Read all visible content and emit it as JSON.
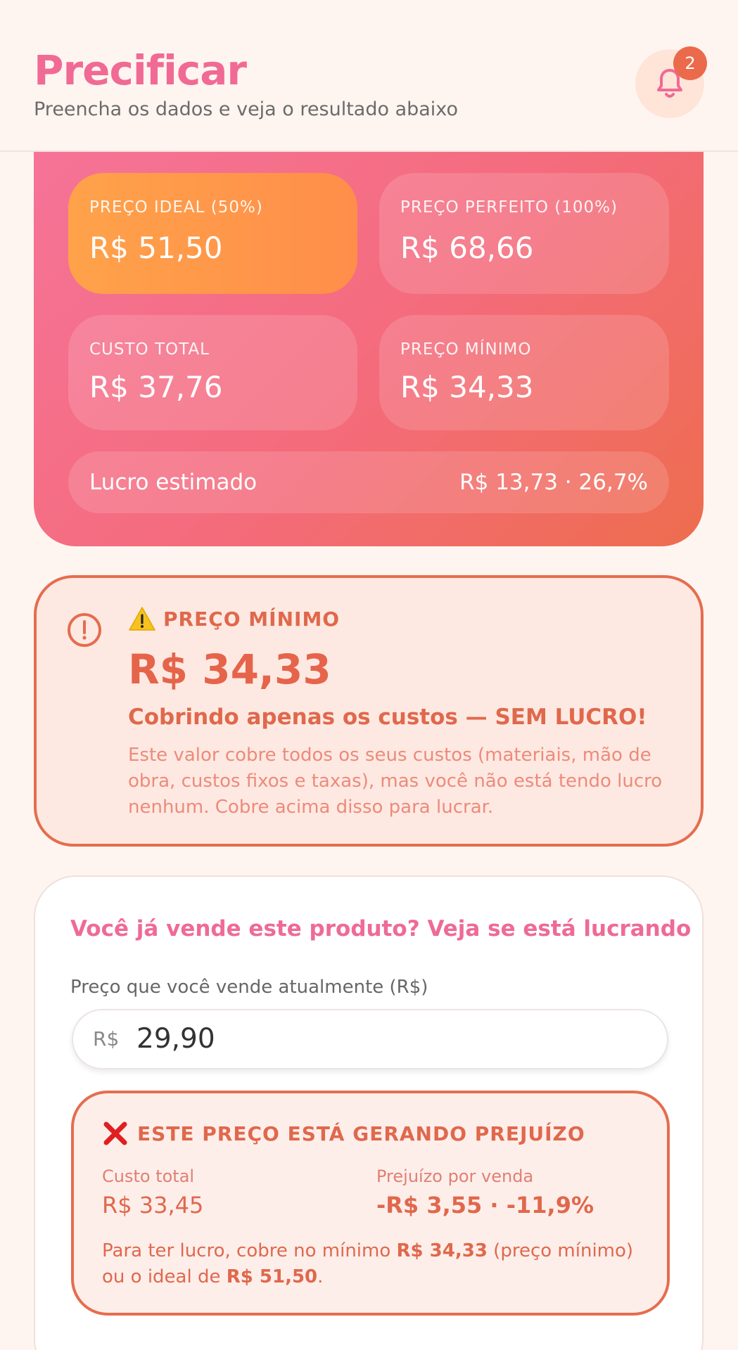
{
  "header": {
    "title": "Precificar",
    "subtitle": "Preencha os dados e veja o resultado abaixo",
    "notification_count": "2"
  },
  "result": {
    "ideal_label": "PREÇO IDEAL (50%)",
    "ideal_value": "R$ 51,50",
    "perfect_label": "PREÇO PERFEITO (100%)",
    "perfect_value": "R$ 68,66",
    "total_cost_label": "CUSTO TOTAL",
    "total_cost_value": "R$ 37,76",
    "min_price_label": "PREÇO MÍNIMO",
    "min_price_value": "R$ 34,33",
    "profit_label": "Lucro estimado",
    "profit_value": "R$ 13,73 · 26,7%"
  },
  "warning": {
    "title": "PREÇO MÍNIMO",
    "amount": "R$ 34,33",
    "headline": "Cobrindo apenas os custos — SEM LUCRO!",
    "description": "Este valor cobre todos os seus custos (materiais, mão de obra, custos fixos e taxas), mas você não está tendo lucro nenhum. Cobre acima disso para lucrar."
  },
  "sale": {
    "title": "Você já vende este produto? Veja se está lucrando",
    "input_label": "Preço que você vende atualmente (R$)",
    "currency_prefix": "R$",
    "input_value": "29,90",
    "loss_title": "ESTE PREÇO ESTÁ GERANDO PREJUÍZO",
    "loss_cost_label": "Custo total",
    "loss_cost_value": "R$ 33,45",
    "loss_per_sale_label": "Prejuízo por venda",
    "loss_per_sale_value": "-R$ 3,55 · -11,9%",
    "note_prefix": "Para ter lucro, cobre no mínimo ",
    "note_min": "R$ 34,33",
    "note_mid": " (preço mínimo) ou o ideal de ",
    "note_ideal": "R$ 51,50",
    "note_suffix": "."
  },
  "colors": {
    "brand_pink": "#f06a95",
    "warning_orange": "#e56d4e",
    "highlight_orange": "#ff8e4a"
  }
}
